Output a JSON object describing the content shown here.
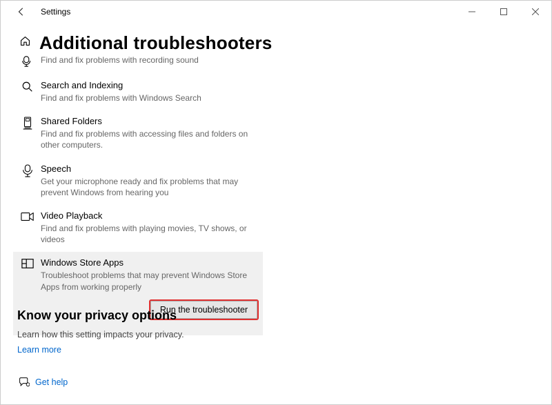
{
  "window": {
    "app_title": "Settings",
    "page_title": "Additional troubleshooters"
  },
  "items": [
    {
      "name": "",
      "desc": "Find and fix problems with recording sound"
    },
    {
      "name": "Search and Indexing",
      "desc": "Find and fix problems with Windows Search"
    },
    {
      "name": "Shared Folders",
      "desc": "Find and fix problems with accessing files and folders on other computers."
    },
    {
      "name": "Speech",
      "desc": "Get your microphone ready and fix problems that may prevent Windows from hearing you"
    },
    {
      "name": "Video Playback",
      "desc": "Find and fix problems with playing movies, TV shows, or videos"
    },
    {
      "name": "Windows Store Apps",
      "desc": "Troubleshoot problems that may prevent Windows Store Apps from working properly"
    }
  ],
  "run_button": "Run the troubleshooter",
  "privacy": {
    "heading": "Know your privacy options",
    "sub": "Learn how this setting impacts your privacy.",
    "learn_more": "Learn more"
  },
  "help": {
    "label": "Get help"
  }
}
